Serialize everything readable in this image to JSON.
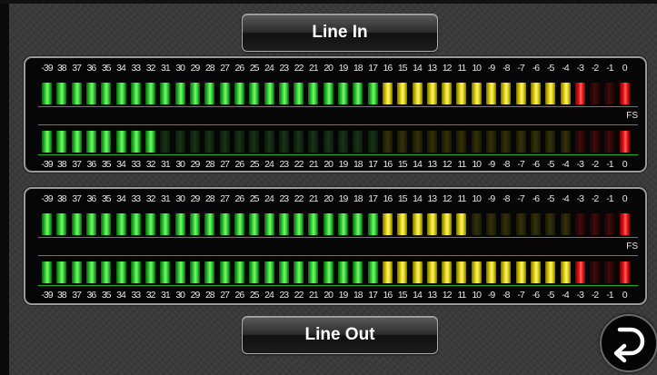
{
  "buttons": {
    "line_in_label": "Line In",
    "line_out_label": "Line Out"
  },
  "return_button": {
    "icon": "return-arrow-icon"
  },
  "scale_labels": [
    "-39",
    "38",
    "37",
    "36",
    "35",
    "34",
    "33",
    "32",
    "31",
    "30",
    "29",
    "28",
    "27",
    "26",
    "25",
    "24",
    "23",
    "22",
    "21",
    "20",
    "19",
    "18",
    "17",
    "16",
    "15",
    "14",
    "13",
    "12",
    "11",
    "10",
    "-9",
    "-8",
    "-7",
    "-6",
    "-5",
    "-4",
    "-3",
    "-2",
    "-1",
    "0"
  ],
  "fs_label": "FS",
  "segment_zones": {
    "green": 23,
    "yellow": 13,
    "red": 4
  },
  "colors": {
    "green": "#2ed12e",
    "yellow": "#ddd10a",
    "red": "#f01515",
    "zero_db_red": "#f01515"
  },
  "panels": {
    "line_in": {
      "meters": [
        {
          "lit_segments": 37,
          "peak_segment": 40
        },
        {
          "lit_segments": 8,
          "peak_segment": 40
        }
      ]
    },
    "line_out": {
      "meters": [
        {
          "lit_segments": 29,
          "peak_segment": 40
        },
        {
          "lit_segments": 37,
          "peak_segment": 40
        }
      ]
    }
  }
}
